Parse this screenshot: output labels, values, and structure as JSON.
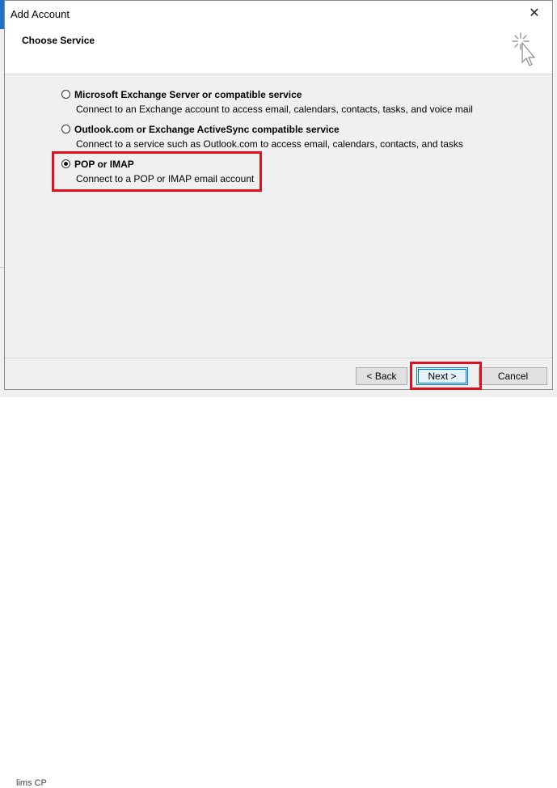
{
  "window": {
    "title": "Add Account",
    "close_glyph": "✕"
  },
  "header": {
    "title": "Choose Service",
    "icon": "setup-wizard-icon"
  },
  "options": [
    {
      "label": "Microsoft Exchange Server or compatible service",
      "description": "Connect to an Exchange account to access email, calendars, contacts, tasks, and voice mail",
      "selected": false
    },
    {
      "label": "Outlook.com or Exchange ActiveSync compatible service",
      "description": "Connect to a service such as Outlook.com to access email, calendars, contacts, and tasks",
      "selected": false
    },
    {
      "label": "POP or IMAP",
      "description": "Connect to a POP or IMAP email account",
      "selected": true
    }
  ],
  "buttons": {
    "back": "< Back",
    "next": "Next >",
    "cancel": "Cancel"
  },
  "background": {
    "bottom_text": "lims CP"
  },
  "colors": {
    "highlight": "#e0101c",
    "focus": "#0078d7"
  }
}
